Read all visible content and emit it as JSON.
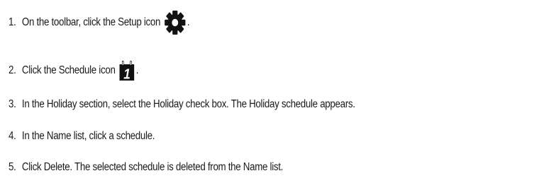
{
  "steps": [
    {
      "number": "1.",
      "text": "On the toolbar, click the Setup icon",
      "icon": "gear-icon",
      "tail": "."
    },
    {
      "number": "2.",
      "text": "Click the Schedule icon",
      "icon": "calendar-icon",
      "icon_glyph": "1",
      "tail": "."
    },
    {
      "number": "3.",
      "text": "In the Holiday section, select the Holiday check box. The Holiday schedule appears."
    },
    {
      "number": "4.",
      "text": "In the Name list, click a schedule."
    },
    {
      "number": "5.",
      "text": "Click Delete. The selected schedule is deleted from the Name list."
    }
  ],
  "colors": {
    "text": "#1a1a1a",
    "icon": "#111111"
  }
}
